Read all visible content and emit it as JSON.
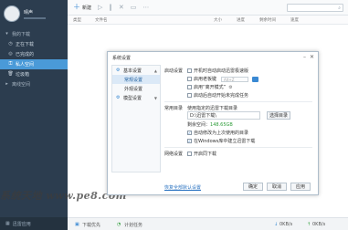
{
  "sidebar": {
    "username": "晴声",
    "items": [
      {
        "label": "我的下载",
        "type": "group",
        "icon": "download-arrow-icon"
      },
      {
        "label": "正在下载",
        "type": "child",
        "icon": "play-circle-icon"
      },
      {
        "label": "已完成的",
        "type": "child",
        "icon": "check-circle-icon"
      },
      {
        "label": "私人空间",
        "type": "child",
        "icon": "lock-icon",
        "active": true
      },
      {
        "label": "垃圾箱",
        "type": "child",
        "icon": "trash-icon"
      },
      {
        "label": "离线空间",
        "type": "group",
        "icon": "cloud-icon"
      }
    ],
    "bottom_label": "迅雷应用"
  },
  "toolbar": {
    "new_label": "新建",
    "icons": [
      "play-icon",
      "pause-icon",
      "close-icon",
      "open-folder-icon",
      "more-icon"
    ],
    "search_placeholder": ""
  },
  "list": {
    "columns": [
      "类型",
      "文件名",
      "大小",
      "进度",
      "剩余时间",
      "速度"
    ]
  },
  "statusbar": {
    "download_priority": "下载优先",
    "scheduled": "计划任务",
    "down_speed": "0KB/s",
    "up_speed": "0KB/s"
  },
  "watermark": "系统天地 www.pe8.com",
  "dialog": {
    "title": "系统设置",
    "nav": [
      {
        "label": "基本设置",
        "type": "group",
        "icon": "gear-icon",
        "caret": "▲"
      },
      {
        "label": "常规设置",
        "type": "sub",
        "selected": true
      },
      {
        "label": "外观设置",
        "type": "sub"
      },
      {
        "label": "模型设置",
        "type": "group",
        "icon": "gear-icon",
        "caret": "▼"
      }
    ],
    "startup": {
      "label": "启动设置",
      "options": [
        {
          "text": "开机时自动启动迅雷极速版",
          "checked": false
        },
        {
          "text": "启用老板键",
          "checked": false,
          "input": "Alt+Z",
          "icon": "keyboard-icon"
        },
        {
          "text": "启用“离开模式”",
          "checked": false,
          "icon": "settings-icon"
        },
        {
          "text": "启动后自动开始未完成任务",
          "checked": false
        }
      ]
    },
    "directory": {
      "label": "常用目录",
      "desc": "使用指定的迅雷下载目录",
      "path": "D:\\迅雷下载\\",
      "browse_label": "选择目录",
      "free_label": "剩余空间：",
      "free_value": "148.65GB",
      "options": [
        {
          "text": "自动修改为上次使用的目录",
          "checked": true
        },
        {
          "text": "在Windows库中建立迅雷下载",
          "checked": true
        }
      ]
    },
    "network": {
      "label": "网络设置",
      "options": [
        {
          "text": "开启同下载",
          "checked": false
        }
      ]
    },
    "restore_link": "恢复全部默认设置",
    "ok_label": "确定",
    "cancel_label": "取消",
    "apply_label": "应用"
  }
}
